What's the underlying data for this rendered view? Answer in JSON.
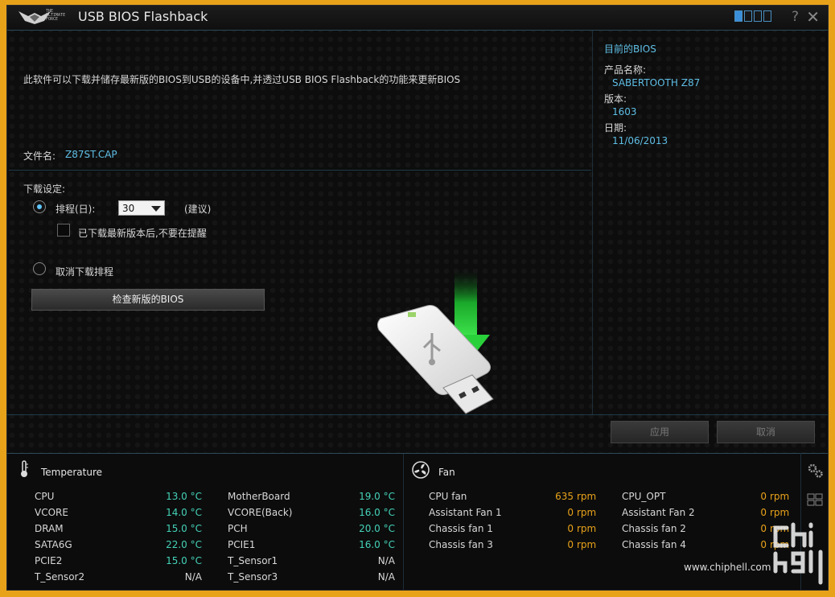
{
  "window": {
    "title": "USB BIOS Flashback",
    "logo_text": [
      "THE",
      "ULTIMATE",
      "FORCE"
    ],
    "help": "?",
    "close": "✕"
  },
  "main": {
    "description": "此软件可以下载并储存最新版的BIOS到USB的设备中,并透过USB BIOS Flashback的功能来更新BIOS",
    "filename_label": "文件名:",
    "filename_value": "Z87ST.CAP",
    "download_settings_label": "下载设定:",
    "schedule_label": "排程(日):",
    "schedule_value": "30",
    "suggest_label": "(建议)",
    "no_remind_label": "已下载最新版本后,不要在提醒",
    "cancel_schedule_label": "取消下载排程",
    "check_button": "检查新版的BIOS"
  },
  "current_bios": {
    "title": "目前的BIOS",
    "product_label": "产品名称:",
    "product_value": "SABERTOOTH Z87",
    "version_label": "版本:",
    "version_value": "1603",
    "date_label": "日期:",
    "date_value": "11/06/2013"
  },
  "actions": {
    "apply": "应用",
    "cancel": "取消"
  },
  "temperature": {
    "title": "Temperature",
    "left": [
      {
        "label": "CPU",
        "value": "13.0 °C"
      },
      {
        "label": "VCORE",
        "value": "14.0 °C"
      },
      {
        "label": "DRAM",
        "value": "15.0 °C"
      },
      {
        "label": "SATA6G",
        "value": "22.0 °C"
      },
      {
        "label": "PCIE2",
        "value": "15.0 °C"
      },
      {
        "label": "T_Sensor2",
        "value": "N/A"
      }
    ],
    "right": [
      {
        "label": "MotherBoard",
        "value": "19.0 °C"
      },
      {
        "label": "VCORE(Back)",
        "value": "16.0 °C"
      },
      {
        "label": "PCH",
        "value": "20.0 °C"
      },
      {
        "label": "PCIE1",
        "value": "16.0 °C"
      },
      {
        "label": "T_Sensor1",
        "value": "N/A"
      },
      {
        "label": "T_Sensor3",
        "value": "N/A"
      }
    ]
  },
  "fan": {
    "title": "Fan",
    "unit": "rpm",
    "left": [
      {
        "label": "CPU fan",
        "value": "635"
      },
      {
        "label": "Assistant Fan 1",
        "value": "0"
      },
      {
        "label": "Chassis fan 1",
        "value": "0"
      },
      {
        "label": "Chassis fan 3",
        "value": "0"
      }
    ],
    "right": [
      {
        "label": "CPU_OPT",
        "value": "0"
      },
      {
        "label": "Assistant Fan 2",
        "value": "0"
      },
      {
        "label": "Chassis fan 2",
        "value": "0"
      },
      {
        "label": "Chassis fan 4",
        "value": "0"
      }
    ]
  },
  "watermark": {
    "site": "www.chiphell.com",
    "logo": "chiphell"
  },
  "colors": {
    "accent_blue": "#5fbfe6",
    "temp_green": "#44d2b8",
    "fan_orange": "#e8a21a"
  }
}
